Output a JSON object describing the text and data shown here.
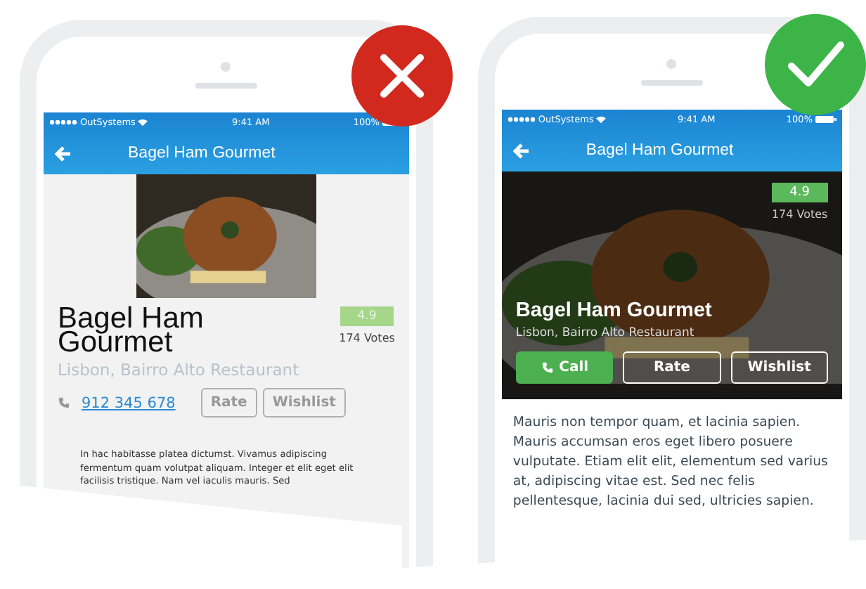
{
  "phones": [
    {
      "kind": "plain",
      "approved": false,
      "status": {
        "carrier": "OutSystems",
        "time": "9:41 AM",
        "battery": "100%"
      },
      "header": {
        "title": "Bagel Ham Gourmet"
      },
      "name": "Bagel Ham Gourmet",
      "rating": "4.9",
      "votes": "174 Votes",
      "location": "Lisbon, Bairro Alto Restaurant",
      "phone_number": "912 345 678",
      "buttons": [
        {
          "label": "Rate",
          "kind": "outline"
        },
        {
          "label": "Wishlist",
          "kind": "outline"
        }
      ],
      "paragraph": "In hac habitasse platea dictumst. Vivamus adipiscing fermentum quam volutpat aliquam. Integer et elit eget elit facilisis tristique. Nam vel iaculis mauris. Sed"
    },
    {
      "kind": "hero",
      "approved": true,
      "status": {
        "carrier": "OutSystems",
        "time": "9:41 AM",
        "battery": "100%"
      },
      "header": {
        "title": "Bagel Ham Gourmet"
      },
      "name": "Bagel Ham Gourmet",
      "rating": "4.9",
      "votes": "174 Votes",
      "location": "Lisbon, Bairro Alto Restaurant",
      "buttons": [
        {
          "label": "Call",
          "kind": "call"
        },
        {
          "label": "Rate",
          "kind": "outline"
        },
        {
          "label": "Wishlist",
          "kind": "outline"
        }
      ],
      "paragraph": "Mauris non tempor quam, et lacinia sapien. Mauris accumsan eros eget libero posuere vulputate. Etiam elit elit, elementum sed varius at, adipiscing vitae est. Sed nec felis pellentesque, lacinia dui sed, ultricies sapien."
    }
  ]
}
